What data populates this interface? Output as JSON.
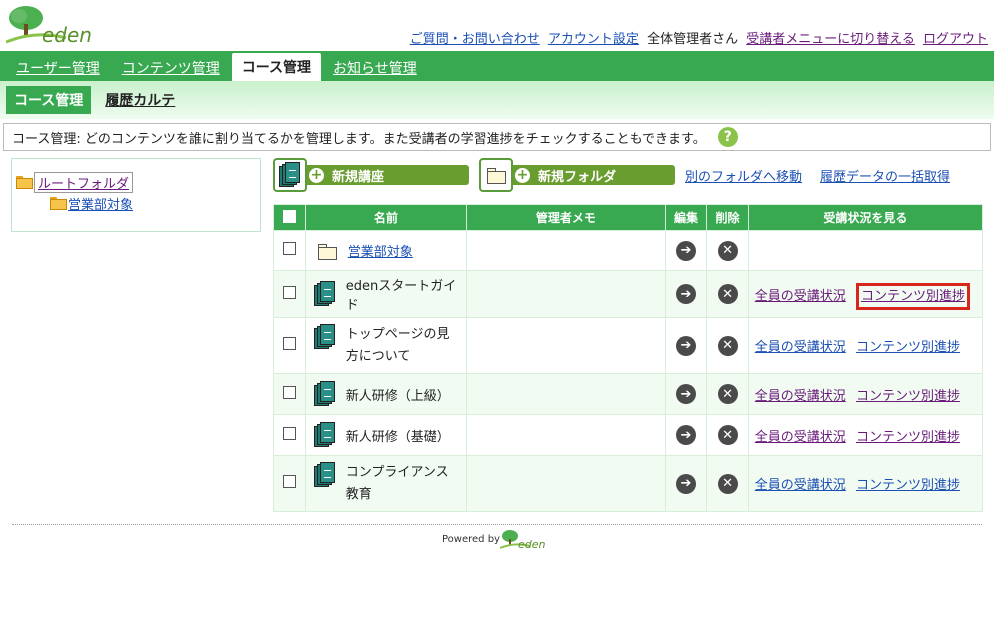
{
  "brand": {
    "logo_text": "eden"
  },
  "header": {
    "faq": "ご質問・お問い合わせ",
    "account": "アカウント設定",
    "user": "全体管理者さん",
    "switch_menu": "受講者メニューに切り替える",
    "logout": "ログアウト"
  },
  "main_nav": {
    "users": "ユーザー管理",
    "contents": "コンテンツ管理",
    "courses": "コース管理",
    "notices": "お知らせ管理"
  },
  "sub_nav": {
    "course_mgmt": "コース管理",
    "history": "履歴カルテ"
  },
  "description": "コース管理: どのコンテンツを誰に割り当てるかを管理します。また受講者の学習進捗をチェックすることもできます。",
  "help_icon": "?",
  "tree": {
    "root": "ルートフォルダ",
    "child": "営業部対象"
  },
  "toolbar": {
    "new_course": "新規講座",
    "new_folder": "新規フォルダ",
    "move": "別のフォルダへ移動",
    "bulk_history": "履歴データの一括取得"
  },
  "table": {
    "headers": {
      "name": "名前",
      "memo": "管理者メモ",
      "edit": "編集",
      "delete": "削除",
      "status": "受講状況を見る"
    },
    "rows": [
      {
        "type": "folder",
        "name": "営業部対象",
        "memo": ""
      },
      {
        "type": "course",
        "name": "edenスタートガイド",
        "memo": "",
        "all_status": "全員の受講状況",
        "by_content": "コンテンツ別進捗"
      },
      {
        "type": "course",
        "name": "トップページの見方について",
        "memo": "",
        "all_status": "全員の受講状況",
        "by_content": "コンテンツ別進捗"
      },
      {
        "type": "course",
        "name": "新人研修（上級）",
        "memo": "",
        "all_status": "全員の受講状況",
        "by_content": "コンテンツ別進捗"
      },
      {
        "type": "course",
        "name": "新人研修（基礎）",
        "memo": "",
        "all_status": "全員の受講状況",
        "by_content": "コンテンツ別進捗"
      },
      {
        "type": "course",
        "name": "コンプライアンス教育",
        "memo": "",
        "all_status": "全員の受講状況",
        "by_content": "コンテンツ別進捗"
      }
    ]
  },
  "footer": {
    "powered_by": "Powered by",
    "logo_text": "eden"
  },
  "colors": {
    "primary_green": "#38a951",
    "button_green": "#6a9d2f",
    "highlight_red": "#d9261c"
  }
}
